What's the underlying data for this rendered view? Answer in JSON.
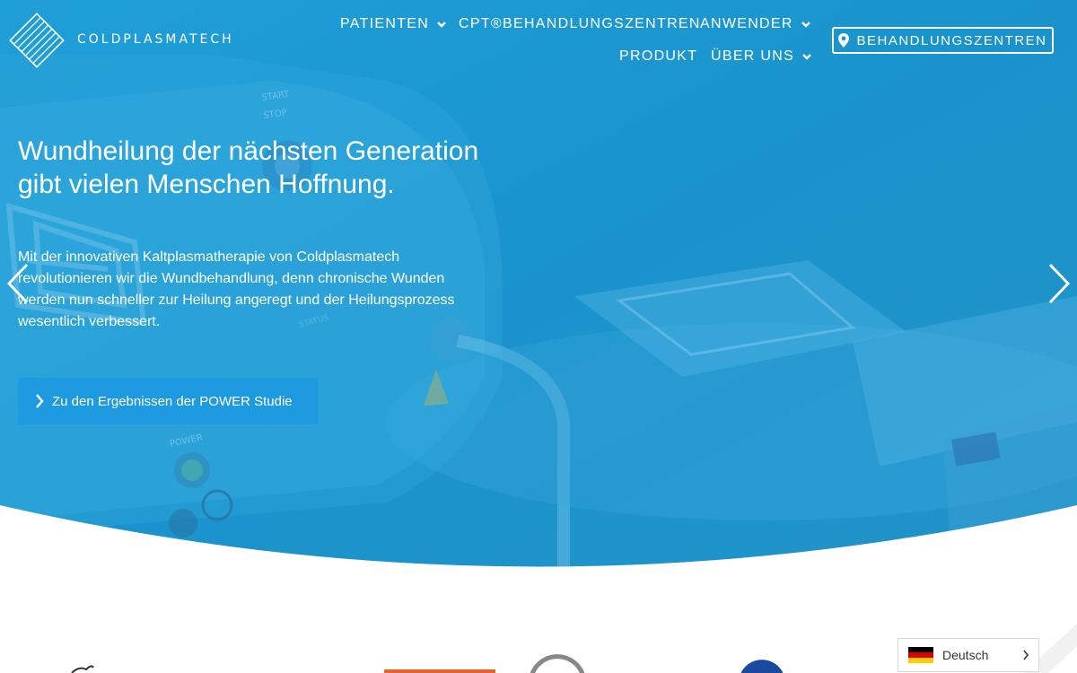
{
  "brand": {
    "name": "COLDPLASMATECH"
  },
  "nav": {
    "items": [
      {
        "label": "PATIENTEN",
        "has_dropdown": true
      },
      {
        "label": "CPT®BEHANDLUNGSZENTREN",
        "has_dropdown": false
      },
      {
        "label": "ANWENDER",
        "has_dropdown": true
      },
      {
        "label": "PRODUKT",
        "has_dropdown": false
      },
      {
        "label": "ÜBER UNS",
        "has_dropdown": true
      }
    ],
    "cta_label": "BEHANDLUNGSZENTREN"
  },
  "hero": {
    "headline_line1": "Wundheilung der nächsten Generation",
    "headline_line2": "gibt vielen Menschen Hoffnung.",
    "lead": "Mit der innovativen Kaltplasmatherapie von Coldplasmatech revolutionieren wir die Wundbehandlung, denn chronische Wunden werden nun schneller zur Heilung angeregt und der Heilungsprozess wesentlich verbessert.",
    "button_label": "Zu den Ergebnissen der POWER Studie",
    "device_labels": {
      "start": "START",
      "stop": "STOP",
      "status": "STATUS",
      "power": "POWER"
    }
  },
  "language": {
    "selected": "Deutsch"
  },
  "colors": {
    "hero_blue": "#1a93cc",
    "button_blue": "#1e9be0"
  }
}
